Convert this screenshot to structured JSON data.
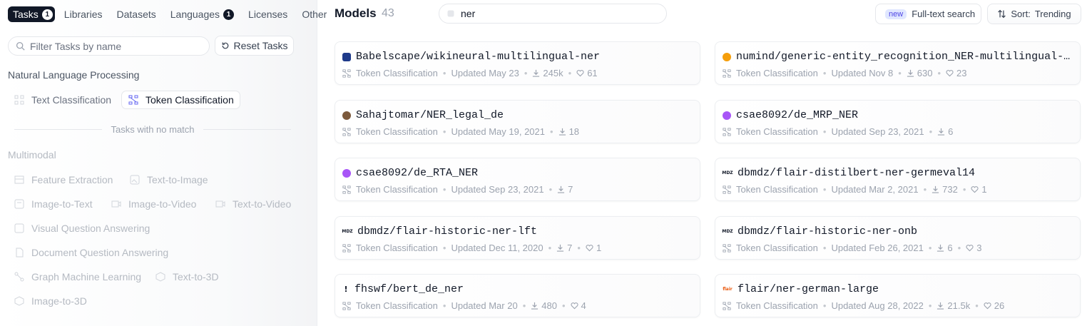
{
  "sidebar": {
    "tabs": [
      {
        "label": "Tasks",
        "badge": "1"
      },
      {
        "label": "Libraries"
      },
      {
        "label": "Datasets"
      },
      {
        "label": "Languages",
        "badge": "1"
      },
      {
        "label": "Licenses"
      },
      {
        "label": "Other"
      }
    ],
    "filter_placeholder": "Filter Tasks by name",
    "reset_label": "Reset Tasks",
    "nlp_title": "Natural Language Processing",
    "nlp_tasks": [
      "Text Classification",
      "Token Classification"
    ],
    "no_match_label": "Tasks with no match",
    "multimodal_title": "Multimodal",
    "multimodal_tasks": [
      "Feature Extraction",
      "Text-to-Image",
      "Image-to-Text",
      "Image-to-Video",
      "Text-to-Video",
      "Visual Question Answering",
      "Document Question Answering",
      "Graph Machine Learning",
      "Text-to-3D",
      "Image-to-3D"
    ]
  },
  "header": {
    "title": "Models",
    "count": "43",
    "search_value": "ner",
    "fts_new": "new",
    "fts_label": "Full-text search",
    "sort_label": "Sort:",
    "sort_value": "Trending"
  },
  "models": [
    {
      "name": "Babelscape/wikineural-multilingual-ner",
      "task": "Token Classification",
      "updated": "Updated May 23",
      "downloads": "245k",
      "likes": "61"
    },
    {
      "name": "numind/generic-entity_recognition_NER-multilingual-…",
      "task": "Token Classification",
      "updated": "Updated Nov 8",
      "downloads": "630",
      "likes": "23"
    },
    {
      "name": "Sahajtomar/NER_legal_de",
      "task": "Token Classification",
      "updated": "Updated May 19, 2021",
      "downloads": "18",
      "likes": null
    },
    {
      "name": "csae8092/de_MRP_NER",
      "task": "Token Classification",
      "updated": "Updated Sep 23, 2021",
      "downloads": "6",
      "likes": null
    },
    {
      "name": "csae8092/de_RTA_NER",
      "task": "Token Classification",
      "updated": "Updated Sep 23, 2021",
      "downloads": "7",
      "likes": null
    },
    {
      "name": "dbmdz/flair-distilbert-ner-germeval14",
      "task": "Token Classification",
      "updated": "Updated Mar 2, 2021",
      "downloads": "732",
      "likes": "1"
    },
    {
      "name": "dbmdz/flair-historic-ner-lft",
      "task": "Token Classification",
      "updated": "Updated Dec 11, 2020",
      "downloads": "7",
      "likes": "1"
    },
    {
      "name": "dbmdz/flair-historic-ner-onb",
      "task": "Token Classification",
      "updated": "Updated Feb 26, 2021",
      "downloads": "6",
      "likes": "3"
    },
    {
      "name": "fhswf/bert_de_ner",
      "task": "Token Classification",
      "updated": "Updated Mar 20",
      "downloads": "480",
      "likes": "4"
    },
    {
      "name": "flair/ner-german-large",
      "task": "Token Classification",
      "updated": "Updated Aug 28, 2022",
      "downloads": "21.5k",
      "likes": "26"
    }
  ],
  "avatar_marks": [
    "",
    "",
    "",
    "",
    "",
    "MDZ",
    "MDZ",
    "MDZ",
    "!",
    "flair"
  ],
  "avatar_colors": [
    "#1e3a8a",
    "#f59e0b",
    "#7c5a3c",
    "#a855f7",
    "#a855f7",
    "#111827",
    "#111827",
    "#111827",
    "#111827",
    "#ea580c"
  ]
}
